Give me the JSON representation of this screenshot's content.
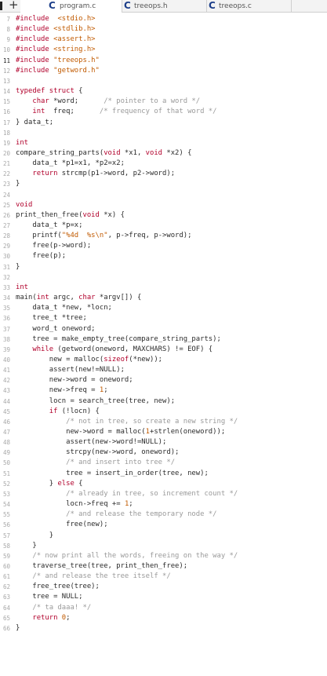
{
  "tabs": [
    {
      "label": "program.c",
      "icon": "c-file-icon",
      "active": true
    },
    {
      "label": "treeops.h",
      "icon": "c-file-icon",
      "active": false
    },
    {
      "label": "treeops.c",
      "icon": "c-file-icon",
      "active": false
    }
  ],
  "tab_icon_glyph": "C",
  "new_tab_glyph": "+",
  "current_line": 11,
  "colors": {
    "keyword": "#b1002b",
    "string": "#c15a00",
    "comment": "#9a9a9a",
    "text": "#2b2b2b",
    "icon": "#1d3f8a"
  },
  "lines": [
    {
      "n": "7",
      "tokens": [
        [
          "pp",
          "#include"
        ],
        [
          "",
          "  "
        ],
        [
          "str",
          "<stdio.h>"
        ]
      ]
    },
    {
      "n": "8",
      "tokens": [
        [
          "pp",
          "#include"
        ],
        [
          "",
          ""
        ],
        [
          "str",
          " <stdlib.h>"
        ]
      ]
    },
    {
      "n": "9",
      "tokens": [
        [
          "pp",
          "#include"
        ],
        [
          "",
          ""
        ],
        [
          "str",
          " <assert.h>"
        ]
      ]
    },
    {
      "n": "10",
      "tokens": [
        [
          "pp",
          "#include"
        ],
        [
          "",
          ""
        ],
        [
          "str",
          " <string.h>"
        ]
      ]
    },
    {
      "n": "11",
      "tokens": [
        [
          "pp",
          "#include"
        ],
        [
          "",
          ""
        ],
        [
          "str",
          " \"treeops.h\""
        ]
      ]
    },
    {
      "n": "12",
      "tokens": [
        [
          "pp",
          "#include"
        ],
        [
          "",
          ""
        ],
        [
          "str",
          " \"getword.h\""
        ]
      ]
    },
    {
      "n": "13",
      "tokens": []
    },
    {
      "n": "14",
      "tokens": [
        [
          "kw",
          "typedef struct"
        ],
        [
          "",
          " {"
        ]
      ]
    },
    {
      "n": "15",
      "tokens": [
        [
          "",
          "    "
        ],
        [
          "kw",
          "char"
        ],
        [
          "",
          " *word;      "
        ],
        [
          "cm",
          "/* pointer to a word */"
        ]
      ]
    },
    {
      "n": "16",
      "tokens": [
        [
          "",
          "    "
        ],
        [
          "kw",
          "int"
        ],
        [
          "",
          "  freq;      "
        ],
        [
          "cm",
          "/* frequency of that word */"
        ]
      ]
    },
    {
      "n": "17",
      "tokens": [
        [
          "",
          "} data_t;"
        ]
      ]
    },
    {
      "n": "18",
      "tokens": []
    },
    {
      "n": "19",
      "tokens": [
        [
          "kw",
          "int"
        ]
      ]
    },
    {
      "n": "20",
      "tokens": [
        [
          "",
          "compare_string_parts("
        ],
        [
          "kw",
          "void"
        ],
        [
          "",
          " *x1, "
        ],
        [
          "kw",
          "void"
        ],
        [
          "",
          " *x2) {"
        ]
      ]
    },
    {
      "n": "21",
      "tokens": [
        [
          "",
          "    data_t *p1=x1, *p2=x2;"
        ]
      ]
    },
    {
      "n": "22",
      "tokens": [
        [
          "",
          "    "
        ],
        [
          "kw",
          "return"
        ],
        [
          "",
          " strcmp(p1->word, p2->word);"
        ]
      ]
    },
    {
      "n": "23",
      "tokens": [
        [
          "",
          "}"
        ]
      ]
    },
    {
      "n": "24",
      "tokens": []
    },
    {
      "n": "25",
      "tokens": [
        [
          "kw",
          "void"
        ]
      ]
    },
    {
      "n": "26",
      "tokens": [
        [
          "",
          "print_then_free("
        ],
        [
          "kw",
          "void"
        ],
        [
          "",
          " *x) {"
        ]
      ]
    },
    {
      "n": "27",
      "tokens": [
        [
          "",
          "    data_t *p=x;"
        ]
      ]
    },
    {
      "n": "28",
      "tokens": [
        [
          "",
          "    printf("
        ],
        [
          "str",
          "\"%4d  %s\\n\""
        ],
        [
          "",
          ", p->freq, p->word);"
        ]
      ]
    },
    {
      "n": "29",
      "tokens": [
        [
          "",
          "    free(p->word);"
        ]
      ]
    },
    {
      "n": "30",
      "tokens": [
        [
          "",
          "    free(p);"
        ]
      ]
    },
    {
      "n": "31",
      "tokens": [
        [
          "",
          "}"
        ]
      ]
    },
    {
      "n": "32",
      "tokens": []
    },
    {
      "n": "33",
      "tokens": [
        [
          "kw",
          "int"
        ]
      ]
    },
    {
      "n": "34",
      "tokens": [
        [
          "",
          "main("
        ],
        [
          "kw",
          "int"
        ],
        [
          "",
          " argc, "
        ],
        [
          "kw",
          "char"
        ],
        [
          "",
          " *argv[]) {"
        ]
      ]
    },
    {
      "n": "35",
      "tokens": [
        [
          "",
          "    data_t *new, *locn;"
        ]
      ]
    },
    {
      "n": "36",
      "tokens": [
        [
          "",
          "    tree_t *tree;"
        ]
      ]
    },
    {
      "n": "37",
      "tokens": [
        [
          "",
          "    word_t oneword;"
        ]
      ]
    },
    {
      "n": "38",
      "tokens": [
        [
          "",
          "    tree = make_empty_tree(compare_string_parts);"
        ]
      ]
    },
    {
      "n": "39",
      "tokens": [
        [
          "",
          "    "
        ],
        [
          "kw",
          "while"
        ],
        [
          "",
          " (getword(oneword, MAXCHARS) != EOF) {"
        ]
      ]
    },
    {
      "n": "40",
      "tokens": [
        [
          "",
          "        new = malloc("
        ],
        [
          "kw",
          "sizeof"
        ],
        [
          "",
          "(*new));"
        ]
      ]
    },
    {
      "n": "41",
      "tokens": [
        [
          "",
          "        assert(new!=NULL);"
        ]
      ]
    },
    {
      "n": "42",
      "tokens": [
        [
          "",
          "        new->word = oneword;"
        ]
      ]
    },
    {
      "n": "43",
      "tokens": [
        [
          "",
          "        new->freq = "
        ],
        [
          "num",
          "1"
        ],
        [
          "",
          ";"
        ]
      ]
    },
    {
      "n": "44",
      "tokens": [
        [
          "",
          "        locn = search_tree(tree, new);"
        ]
      ]
    },
    {
      "n": "45",
      "tokens": [
        [
          "",
          "        "
        ],
        [
          "kw",
          "if"
        ],
        [
          "",
          " (!locn) {"
        ]
      ]
    },
    {
      "n": "46",
      "tokens": [
        [
          "",
          "            "
        ],
        [
          "cm",
          "/* not in tree, so create a new string */"
        ]
      ]
    },
    {
      "n": "47",
      "tokens": [
        [
          "",
          "            new->word = malloc("
        ],
        [
          "num",
          "1"
        ],
        [
          "",
          "+strlen(oneword));"
        ]
      ]
    },
    {
      "n": "48",
      "tokens": [
        [
          "",
          "            assert(new->word!=NULL);"
        ]
      ]
    },
    {
      "n": "49",
      "tokens": [
        [
          "",
          "            strcpy(new->word, oneword);"
        ]
      ]
    },
    {
      "n": "50",
      "tokens": [
        [
          "",
          "            "
        ],
        [
          "cm",
          "/* and insert into tree */"
        ]
      ]
    },
    {
      "n": "51",
      "tokens": [
        [
          "",
          "            tree = insert_in_order(tree, new);"
        ]
      ]
    },
    {
      "n": "52",
      "tokens": [
        [
          "",
          "        } "
        ],
        [
          "kw",
          "else"
        ],
        [
          "",
          " {"
        ]
      ]
    },
    {
      "n": "53",
      "tokens": [
        [
          "",
          "            "
        ],
        [
          "cm",
          "/* already in tree, so increment count */"
        ]
      ]
    },
    {
      "n": "54",
      "tokens": [
        [
          "",
          "            locn->freq += "
        ],
        [
          "num",
          "1"
        ],
        [
          "",
          ";"
        ]
      ]
    },
    {
      "n": "55",
      "tokens": [
        [
          "",
          "            "
        ],
        [
          "cm",
          "/* and release the temporary node */"
        ]
      ]
    },
    {
      "n": "56",
      "tokens": [
        [
          "",
          "            free(new);"
        ]
      ]
    },
    {
      "n": "57",
      "tokens": [
        [
          "",
          "        }"
        ]
      ]
    },
    {
      "n": "58",
      "tokens": [
        [
          "",
          "    }"
        ]
      ]
    },
    {
      "n": "59",
      "tokens": [
        [
          "",
          "    "
        ],
        [
          "cm",
          "/* now print all the words, freeing on the way */"
        ]
      ]
    },
    {
      "n": "60",
      "tokens": [
        [
          "",
          "    traverse_tree(tree, print_then_free);"
        ]
      ]
    },
    {
      "n": "61",
      "tokens": [
        [
          "",
          "    "
        ],
        [
          "cm",
          "/* and release the tree itself */"
        ]
      ]
    },
    {
      "n": "62",
      "tokens": [
        [
          "",
          "    free_tree(tree);"
        ]
      ]
    },
    {
      "n": "63",
      "tokens": [
        [
          "",
          "    tree = NULL;"
        ]
      ]
    },
    {
      "n": "64",
      "tokens": [
        [
          "",
          "    "
        ],
        [
          "cm",
          "/* ta daaa! */"
        ]
      ]
    },
    {
      "n": "65",
      "tokens": [
        [
          "",
          "    "
        ],
        [
          "kw",
          "return"
        ],
        [
          "",
          " "
        ],
        [
          "num",
          "0"
        ],
        [
          "",
          ";"
        ]
      ]
    },
    {
      "n": "66",
      "tokens": [
        [
          "",
          "}"
        ]
      ]
    }
  ]
}
